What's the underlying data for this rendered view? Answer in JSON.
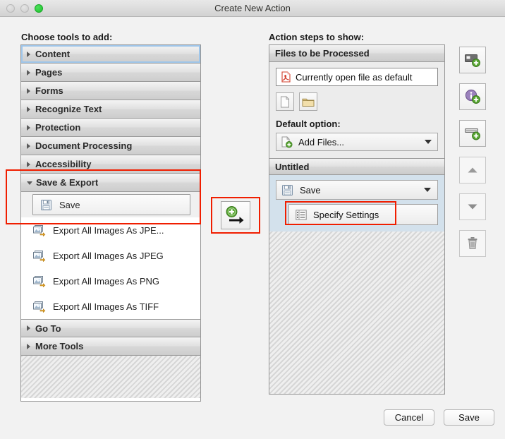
{
  "window": {
    "title": "Create New Action",
    "traffic_lights": [
      "close-button",
      "minimize-button",
      "maximize-button"
    ]
  },
  "left_panel": {
    "label": "Choose tools to add:",
    "categories": [
      {
        "label": "Content",
        "expanded": false,
        "focused": true
      },
      {
        "label": "Pages",
        "expanded": false,
        "focused": false
      },
      {
        "label": "Forms",
        "expanded": false,
        "focused": false
      },
      {
        "label": "Recognize Text",
        "expanded": false,
        "focused": false
      },
      {
        "label": "Protection",
        "expanded": false,
        "focused": false
      },
      {
        "label": "Document Processing",
        "expanded": false,
        "focused": false
      },
      {
        "label": "Accessibility",
        "expanded": false,
        "focused": false
      },
      {
        "label": "Save & Export",
        "expanded": true,
        "focused": false
      },
      {
        "label": "Go To",
        "expanded": false,
        "focused": false
      },
      {
        "label": "More Tools",
        "expanded": false,
        "focused": false
      }
    ],
    "tools": [
      {
        "label": "Save",
        "icon": "floppy-disk-icon",
        "selected": true
      },
      {
        "label": "Export All Images As JPE...",
        "icon": "export-images-icon",
        "selected": false
      },
      {
        "label": "Export All Images As JPEG",
        "icon": "export-images-icon",
        "selected": false
      },
      {
        "label": "Export All Images As PNG",
        "icon": "export-images-icon",
        "selected": false
      },
      {
        "label": "Export All Images As TIFF",
        "icon": "export-images-icon",
        "selected": false
      }
    ]
  },
  "add_button": {
    "icon": "add-arrow-icon",
    "highlighted": true
  },
  "right_panel": {
    "label": "Action steps to show:",
    "groups": [
      {
        "title": "Files to be Processed",
        "file_field": {
          "icon": "pdf-file-icon",
          "value": "Currently open file as default"
        },
        "buttons": [
          {
            "icon": "document-icon",
            "name": "add-file-button"
          },
          {
            "icon": "folder-icon",
            "name": "add-folder-button"
          }
        ],
        "option_label": "Default option:",
        "option_value": "Add Files...",
        "option_icon": "document-add-icon"
      },
      {
        "title": "Untitled",
        "step": {
          "label": "Save",
          "icon": "floppy-disk-icon"
        },
        "substep": {
          "label": "Specify Settings",
          "icon": "settings-list-icon",
          "highlighted": true
        }
      }
    ]
  },
  "side_toolbar": [
    {
      "name": "add-panel-button",
      "icon": "panel-add-icon"
    },
    {
      "name": "add-info-button",
      "icon": "info-add-icon"
    },
    {
      "name": "add-divider-button",
      "icon": "divider-add-icon"
    },
    {
      "name": "move-up-button",
      "icon": "triangle-up-icon"
    },
    {
      "name": "move-down-button",
      "icon": "triangle-down-icon"
    },
    {
      "name": "delete-button",
      "icon": "trash-icon"
    }
  ],
  "footer": {
    "cancel_label": "Cancel",
    "save_label": "Save"
  },
  "colors": {
    "highlight_red": "#f01e00",
    "selection_blue": "#d3e1ec",
    "focus_ring": "#9fc6ea",
    "green_accent": "#5aa833",
    "maximize_green": "#1fc22f"
  }
}
